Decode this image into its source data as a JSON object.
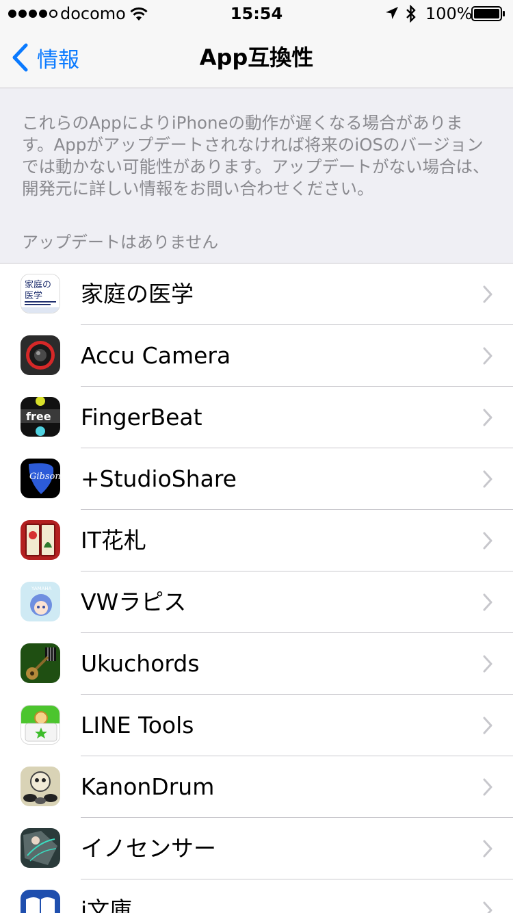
{
  "status_bar": {
    "carrier": "docomo",
    "time": "15:54",
    "battery": "100%",
    "signal_bars": 4,
    "icons": [
      "wifi-icon",
      "location-arrow-icon",
      "bluetooth-icon",
      "battery-icon"
    ]
  },
  "nav": {
    "back_label": "情報",
    "title": "App互換性"
  },
  "description": "これらのAppによりiPhoneの動作が遅くなる場合がありま\nす。Appがアップデートされなければ将来のiOSのバージョン\nでは動かない可能性があります。アップデートがない場合は、\n開発元に詳しい情報をお問い合わせください。",
  "section_header": "アップデートはありません",
  "apps": [
    {
      "name": "家庭の医学",
      "icon": "katei-no-igaku-icon"
    },
    {
      "name": "Accu Camera",
      "icon": "accu-camera-icon"
    },
    {
      "name": "FingerBeat",
      "icon": "fingerbeat-icon"
    },
    {
      "name": "+StudioShare",
      "icon": "studioshare-icon"
    },
    {
      "name": "IT花札",
      "icon": "it-hanafuda-icon"
    },
    {
      "name": "VWラピス",
      "icon": "vw-lapis-icon"
    },
    {
      "name": "Ukuchords",
      "icon": "ukuchords-icon"
    },
    {
      "name": "LINE Tools",
      "icon": "line-tools-icon"
    },
    {
      "name": "KanonDrum",
      "icon": "kanondrum-icon"
    },
    {
      "name": "イノセンサー",
      "icon": "innocenser-icon"
    },
    {
      "name": "i文庫",
      "icon": "i-bunko-icon"
    }
  ],
  "colors": {
    "tint": "#0a7aff",
    "background": "#efeff4",
    "separator": "#c8c7cc",
    "secondary_text": "#8a8a8f"
  }
}
